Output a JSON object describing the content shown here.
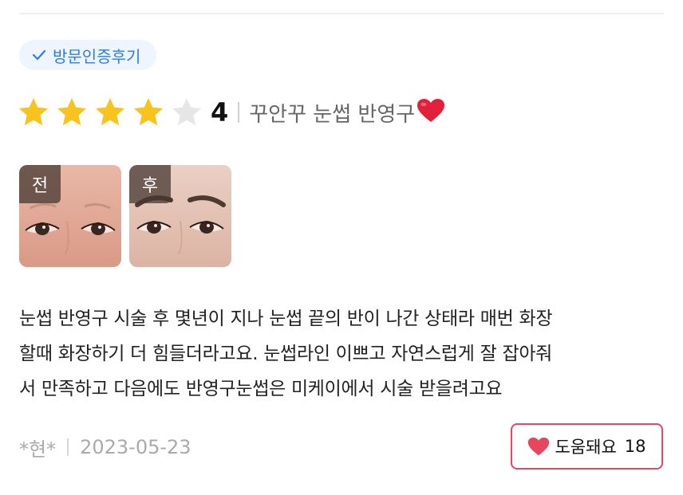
{
  "badge": {
    "label": "방문인증후기",
    "icon": "check-icon",
    "color": "#2f7be5"
  },
  "rating": {
    "value": 4,
    "max": 5,
    "display": "4",
    "star_filled_color": "#f7c31c",
    "star_empty_color": "#e6e6e6"
  },
  "product": {
    "name": "꾸안꾸 눈썹 반영구",
    "emoji_icon": "red-heart-icon"
  },
  "photos": [
    {
      "tag": "전"
    },
    {
      "tag": "후"
    }
  ],
  "review": {
    "lines": [
      "눈썹 반영구 시술 후 몇년이 지나 눈썹 끝의 반이 나간 상태라 매번 화장",
      "할때 화장하기 더 힘들더라고요. 눈썹라인 이쁘고 자연스럽게 잘 잡아줘",
      "서 만족하고 다음에도 반영구눈썹은 미케이에서 시술 받을려고요"
    ]
  },
  "meta": {
    "author": "*현*",
    "date": "2023-05-23"
  },
  "helpful": {
    "label": "도움돼요",
    "count": "18",
    "accent": "#e8465e"
  }
}
